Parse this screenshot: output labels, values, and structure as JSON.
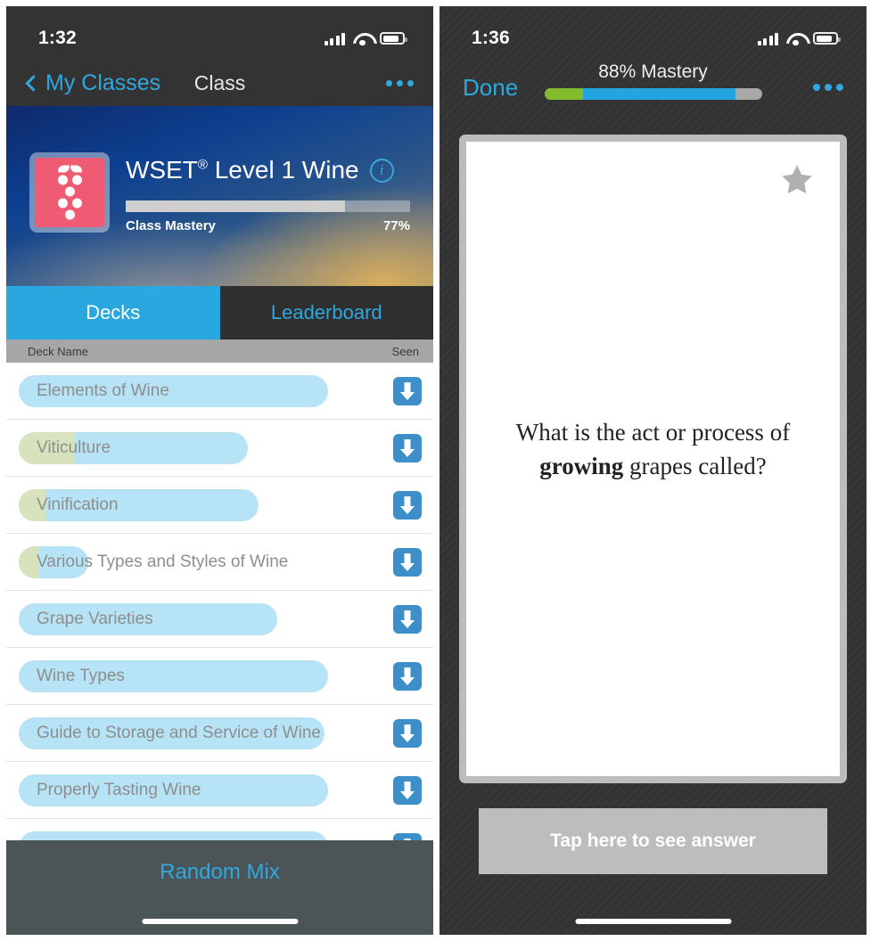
{
  "left": {
    "status": {
      "time": "1:32",
      "cellular_icon": "cellular-bars-icon",
      "wifi_icon": "wifi-icon",
      "battery_icon": "battery-icon"
    },
    "nav": {
      "back_label": "My Classes",
      "title": "Class",
      "more_icon": "more-dots-icon"
    },
    "hero": {
      "app_icon": "grape-cluster-icon",
      "class_name": "WSET",
      "class_name_sup": "®",
      "class_name_rest": "Level 1 Wine",
      "info_icon": "info-circle-icon",
      "mastery_label": "Class Mastery",
      "mastery_percent": "77%",
      "mastery_value": 77
    },
    "tabs": [
      {
        "label": "Decks",
        "active": true
      },
      {
        "label": "Leaderboard",
        "active": false
      }
    ],
    "list_header": {
      "name_col": "Deck Name",
      "seen_col": "Seen"
    },
    "decks": [
      {
        "name": "Elements of Wine",
        "pill_pct": 85,
        "green_pct": 0,
        "download_icon": "download-icon"
      },
      {
        "name": "Viticulture",
        "pill_pct": 63,
        "green_pct": 24,
        "download_icon": "download-icon"
      },
      {
        "name": "Vinification",
        "pill_pct": 66,
        "green_pct": 11,
        "download_icon": "download-icon"
      },
      {
        "name": "Various Types and Styles of Wine",
        "pill_pct": 19,
        "green_pct": 30,
        "download_icon": "download-icon"
      },
      {
        "name": "Grape Varieties",
        "pill_pct": 71,
        "green_pct": 0,
        "download_icon": "download-icon"
      },
      {
        "name": "Wine Types",
        "pill_pct": 85,
        "green_pct": 0,
        "download_icon": "download-icon"
      },
      {
        "name": "Guide to Storage and Service of Wine",
        "pill_pct": 84,
        "green_pct": 0,
        "download_icon": "download-icon"
      },
      {
        "name": "Properly Tasting Wine",
        "pill_pct": 85,
        "green_pct": 0,
        "download_icon": "download-icon"
      },
      {
        "name": "",
        "pill_pct": 85,
        "green_pct": 0,
        "download_icon": "download-icon"
      }
    ],
    "bottom": {
      "random_mix_label": "Random Mix"
    }
  },
  "right": {
    "status": {
      "time": "1:36",
      "cellular_icon": "cellular-bars-icon",
      "wifi_icon": "wifi-icon",
      "battery_icon": "battery-icon"
    },
    "nav": {
      "done_label": "Done",
      "more_icon": "more-dots-icon"
    },
    "mastery": {
      "label": "88% Mastery",
      "value": 88,
      "green_pct": 18,
      "blue_pct": 70,
      "gray_pct": 12
    },
    "card": {
      "star_icon": "star-icon",
      "question_line1": "What is the act or process of",
      "question_bold": "growing",
      "question_line2_rest": " grapes called?"
    },
    "answer_button": {
      "label": "Tap here to see answer"
    }
  },
  "colors": {
    "accent_blue": "#2fa8e0",
    "tab_blue": "#29a8e0",
    "pill_blue": "#b6e3f5",
    "pill_green": "#d6e3bd",
    "mastery_green": "#82bb2c",
    "mastery_blue": "#23a6df",
    "icon_pink": "#ef5b72",
    "dark_chrome": "#333333"
  }
}
